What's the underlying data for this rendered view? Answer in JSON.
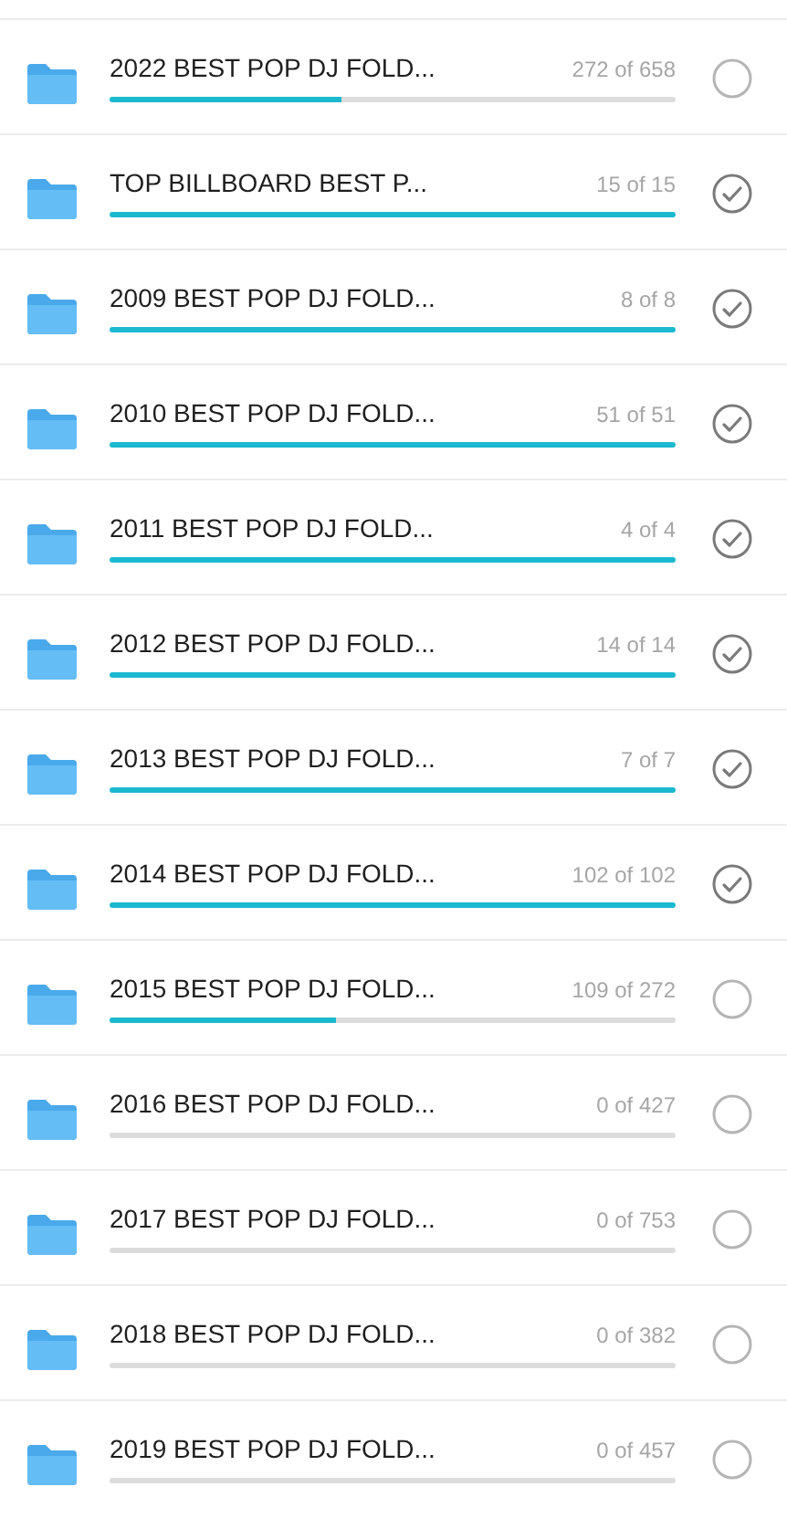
{
  "folders": [
    {
      "name": "2022 BEST POP DJ FOLD...",
      "count": "272 of 658",
      "level": 0.41,
      "checked": false
    },
    {
      "name": "TOP BILLBOARD BEST P...",
      "count": "15 of 15",
      "level": 1,
      "checked": true
    },
    {
      "name": "2009 BEST POP DJ FOLD...",
      "count": "8 of 8",
      "level": 1,
      "checked": true
    },
    {
      "name": "2010 BEST POP DJ FOLD...",
      "count": "51 of 51",
      "level": 1,
      "checked": true
    },
    {
      "name": "2011 BEST POP DJ FOLD...",
      "count": "4 of 4",
      "level": 1,
      "checked": true
    },
    {
      "name": "2012 BEST POP DJ FOLD...",
      "count": "14 of 14",
      "level": 1,
      "checked": true
    },
    {
      "name": "2013 BEST POP DJ FOLD...",
      "count": "7 of 7",
      "level": 1,
      "checked": true
    },
    {
      "name": "2014 BEST POP DJ FOLD...",
      "count": "102 of 102",
      "level": 1,
      "checked": true
    },
    {
      "name": "2015 BEST POP DJ FOLD...",
      "count": "109 of 272",
      "level": 0.4,
      "checked": false
    },
    {
      "name": "2016 BEST POP DJ FOLD...",
      "count": "0 of 427",
      "level": 0,
      "checked": false
    },
    {
      "name": "2017 BEST POP DJ FOLD...",
      "count": "0 of 753",
      "level": 0,
      "checked": false
    },
    {
      "name": "2018 BEST POP DJ FOLD...",
      "count": "0 of 382",
      "level": 0,
      "checked": false
    },
    {
      "name": "2019 BEST POP DJ FOLD...",
      "count": "0 of 457",
      "level": 0,
      "checked": false
    }
  ]
}
